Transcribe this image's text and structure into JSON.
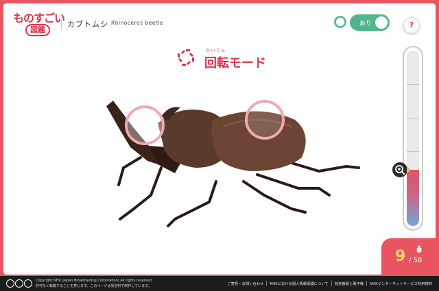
{
  "header": {
    "logo_text": "ものすごい",
    "logo_badge": "図鑑",
    "creature_name_jp": "カブトムシ",
    "creature_name_en": "Rhinoceros beetle",
    "toggle_label": "あり",
    "toggle_on": true,
    "help_label": "?"
  },
  "mode": {
    "ruby": "かいてん",
    "title": "回転モード",
    "icon": "rotate-icon"
  },
  "viewer": {
    "image_alt": "Rhinoceros beetle",
    "rotation_handles": 2,
    "zoom_level": 0.32
  },
  "counter": {
    "current": "9",
    "total": "/ 58",
    "icon": "beetle-icon"
  },
  "footer": {
    "copyright_line1": "Copyright NHK (Japan Broadcasting Corporation) All rights reserved.",
    "copyright_line2": "許可なく転載することを禁じます。このページは受信料で制作しています。",
    "links": [
      "ご意見・お問い合わせ",
      "NHKにおける個人情報保護について",
      "放送番組と著作権",
      "NHKインターネットサービス利用規約"
    ]
  },
  "colors": {
    "frame": "#e8545f",
    "accent": "#d8344a",
    "toggle": "#4fb58c",
    "handle": "#f2a7b4"
  }
}
